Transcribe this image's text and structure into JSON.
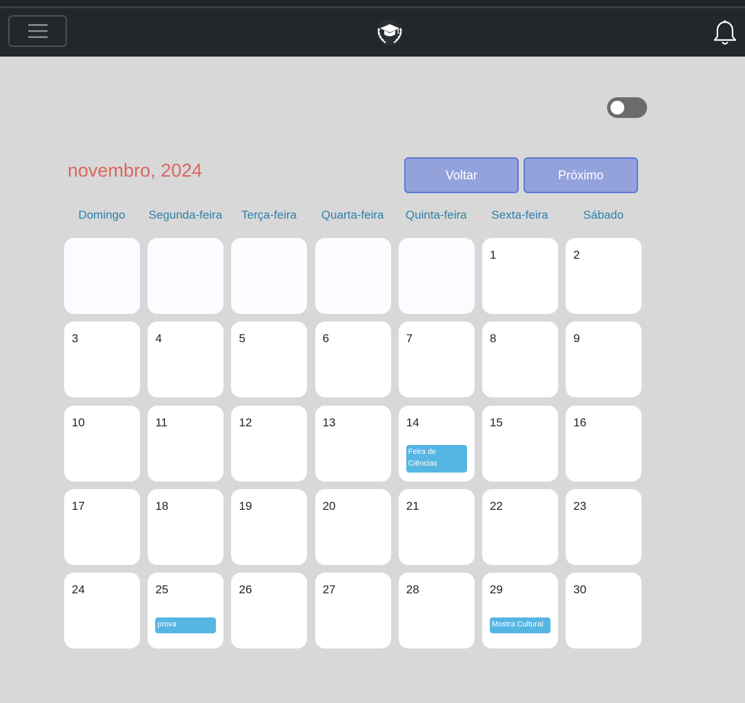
{
  "header": {
    "menu_icon": "hamburger-icon",
    "logo_icon": "graduation-cap-laurel-logo",
    "notification_icon": "bell-icon",
    "colors": {
      "navbar": "#23272b",
      "background": "#d8d8d8"
    }
  },
  "theme_toggle": {
    "state": "off"
  },
  "calendar": {
    "title": "novembro, 2024",
    "back_label": "Voltar",
    "next_label": "Próximo",
    "weekdays": [
      "Domingo",
      "Segunda-feira",
      "Terça-feira",
      "Quarta-feira",
      "Quinta-feira",
      "Sexta-feira",
      "Sábado"
    ],
    "days": [
      "",
      "",
      "",
      "",
      "",
      "1",
      "2",
      "3",
      "4",
      "5",
      "6",
      "7",
      "8",
      "9",
      "10",
      "11",
      "12",
      "13",
      "14",
      "15",
      "16",
      "17",
      "18",
      "19",
      "20",
      "21",
      "22",
      "23",
      "24",
      "25",
      "26",
      "27",
      "28",
      "29",
      "30"
    ],
    "events": {
      "day14": "Feira de Ciências",
      "day25": "prova",
      "day29": "Mostra Cultural"
    },
    "colors": {
      "title": "#d9675f",
      "weekday": "#2e7fa8",
      "event": "#56b6e3",
      "button": "#94a2dc"
    }
  }
}
